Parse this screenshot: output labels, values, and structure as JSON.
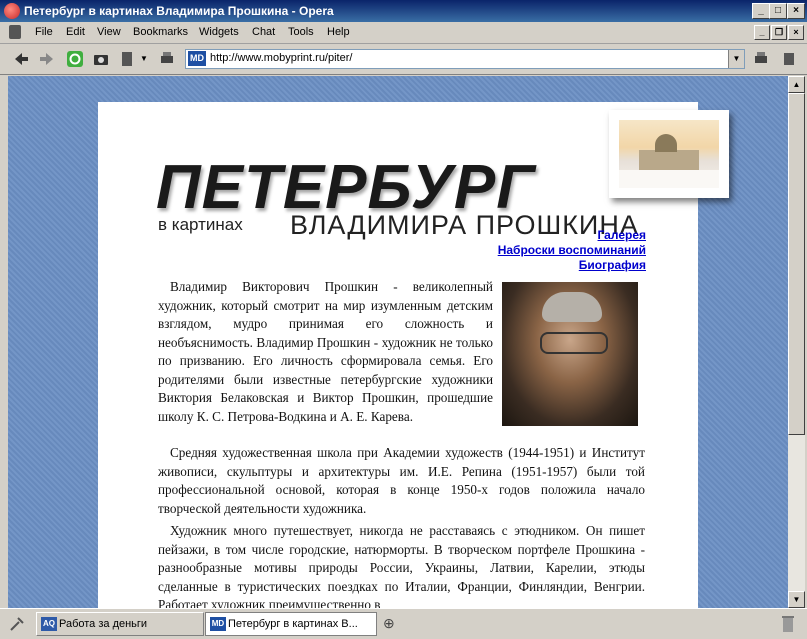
{
  "window": {
    "title": "Петербург в картинах Владимира Прошкина - Opera"
  },
  "menu": {
    "items": [
      "File",
      "Edit",
      "View",
      "Bookmarks",
      "Widgets",
      "Chat",
      "Tools",
      "Help"
    ]
  },
  "toolbar": {
    "address": "http://www.mobyprint.ru/piter/",
    "favicon_text": "MD"
  },
  "page": {
    "title": "ПЕТЕРБУРГ",
    "subtitle_small": "в картинах",
    "subtitle_big": "ВЛАДИМИРА ПРОШКИНА",
    "nav": [
      "Галерея",
      "Наброски воспоминаний",
      "Биография"
    ],
    "paragraphs": [
      "Владимир Викторович Прошкин - великолепный художник, который смотрит на мир изумленным детским взглядом, мудро принимая его сложность и необъяснимость. Владимир Прошкин - художник не только по призванию. Его личность сформировала семья. Его родителями были известные петербургские художники Виктория Белаковская и Виктор Прошкин, прошедшие школу К. С. Петрова-Водкина и А. Е. Карева.",
      "Средняя художественная школа при Академии художеств (1944-1951) и Институт живописи, скульптуры и архитектуры им. И.Е. Репина (1951-1957) были той профессиональной основой, которая в конце 1950-х годов положила начало творческой деятельности художника.",
      "Художник много путешествует, никогда не расставаясь с этюдником. Он пишет пейзажи, в том числе городские, натюрморты. В творческом портфеле Прошкина - разнообразные мотивы природы России, Украины, Латвии, Карелии, этюды сделанные в туристических поездках по Италии, Франции, Финляндии, Венгрии. Работает художник преимущественно в"
    ]
  },
  "tabs": [
    {
      "label": "Работа за деньги",
      "icon_text": "AQ",
      "active": false
    },
    {
      "label": "Петербург в картинах В...",
      "icon_text": "MD",
      "active": true
    }
  ],
  "colors": {
    "titlebar": "#0a246a",
    "background": "#6b8fc4",
    "link": "#0000cc"
  }
}
